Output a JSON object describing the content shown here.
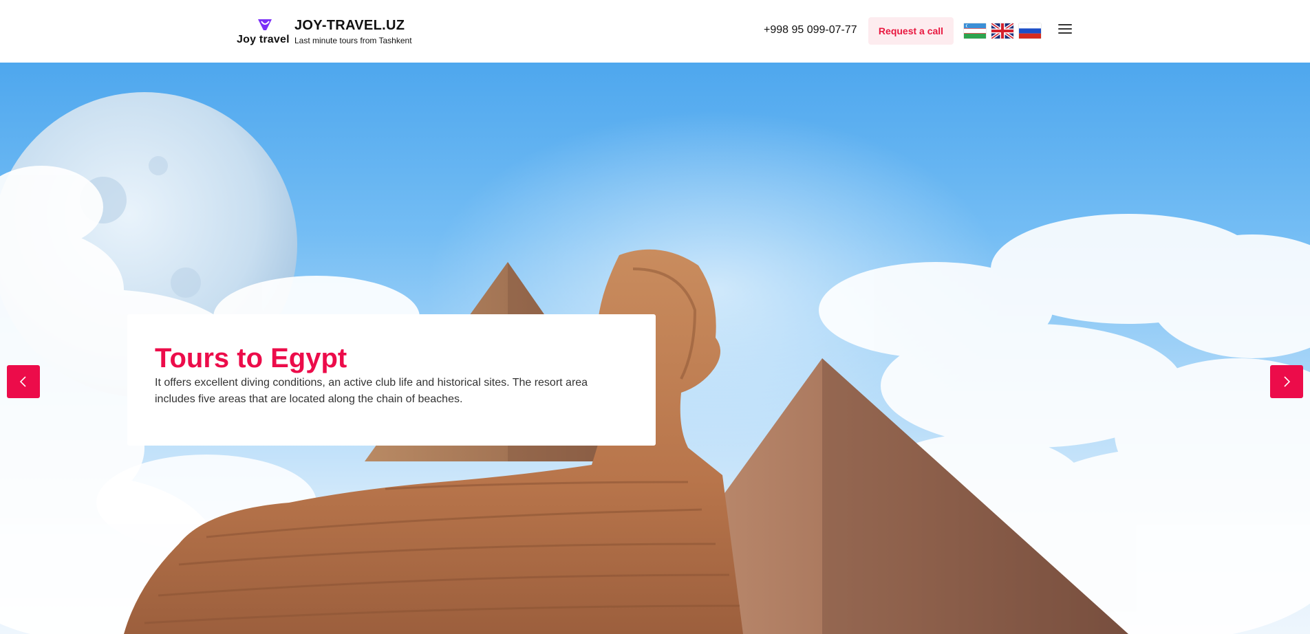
{
  "header": {
    "logo_text": "Joy travel",
    "site_title": "JOY-TRAVEL.UZ",
    "tagline": "Last minute tours from Tashkent",
    "phone": "+998 95 099-07-77",
    "call_button": "Request a call",
    "languages": [
      {
        "code": "uz",
        "icon": "flag-uzbekistan-icon"
      },
      {
        "code": "en",
        "icon": "flag-united-kingdom-icon"
      },
      {
        "code": "ru",
        "icon": "flag-russia-icon"
      }
    ],
    "menu_icon": "hamburger-menu-icon"
  },
  "slider": {
    "current": {
      "title": "Tours to Egypt",
      "description": "It offers excellent diving conditions, an active club life and historical sites. The resort area includes five areas that are located along the chain of beaches."
    },
    "prev_icon": "chevron-left-icon",
    "next_icon": "chevron-right-icon"
  },
  "colors": {
    "accent": "#ec0c4a",
    "call_button_bg": "#fdecef",
    "call_button_text": "#e8173f",
    "logo_purple": "#7b2ff7"
  }
}
